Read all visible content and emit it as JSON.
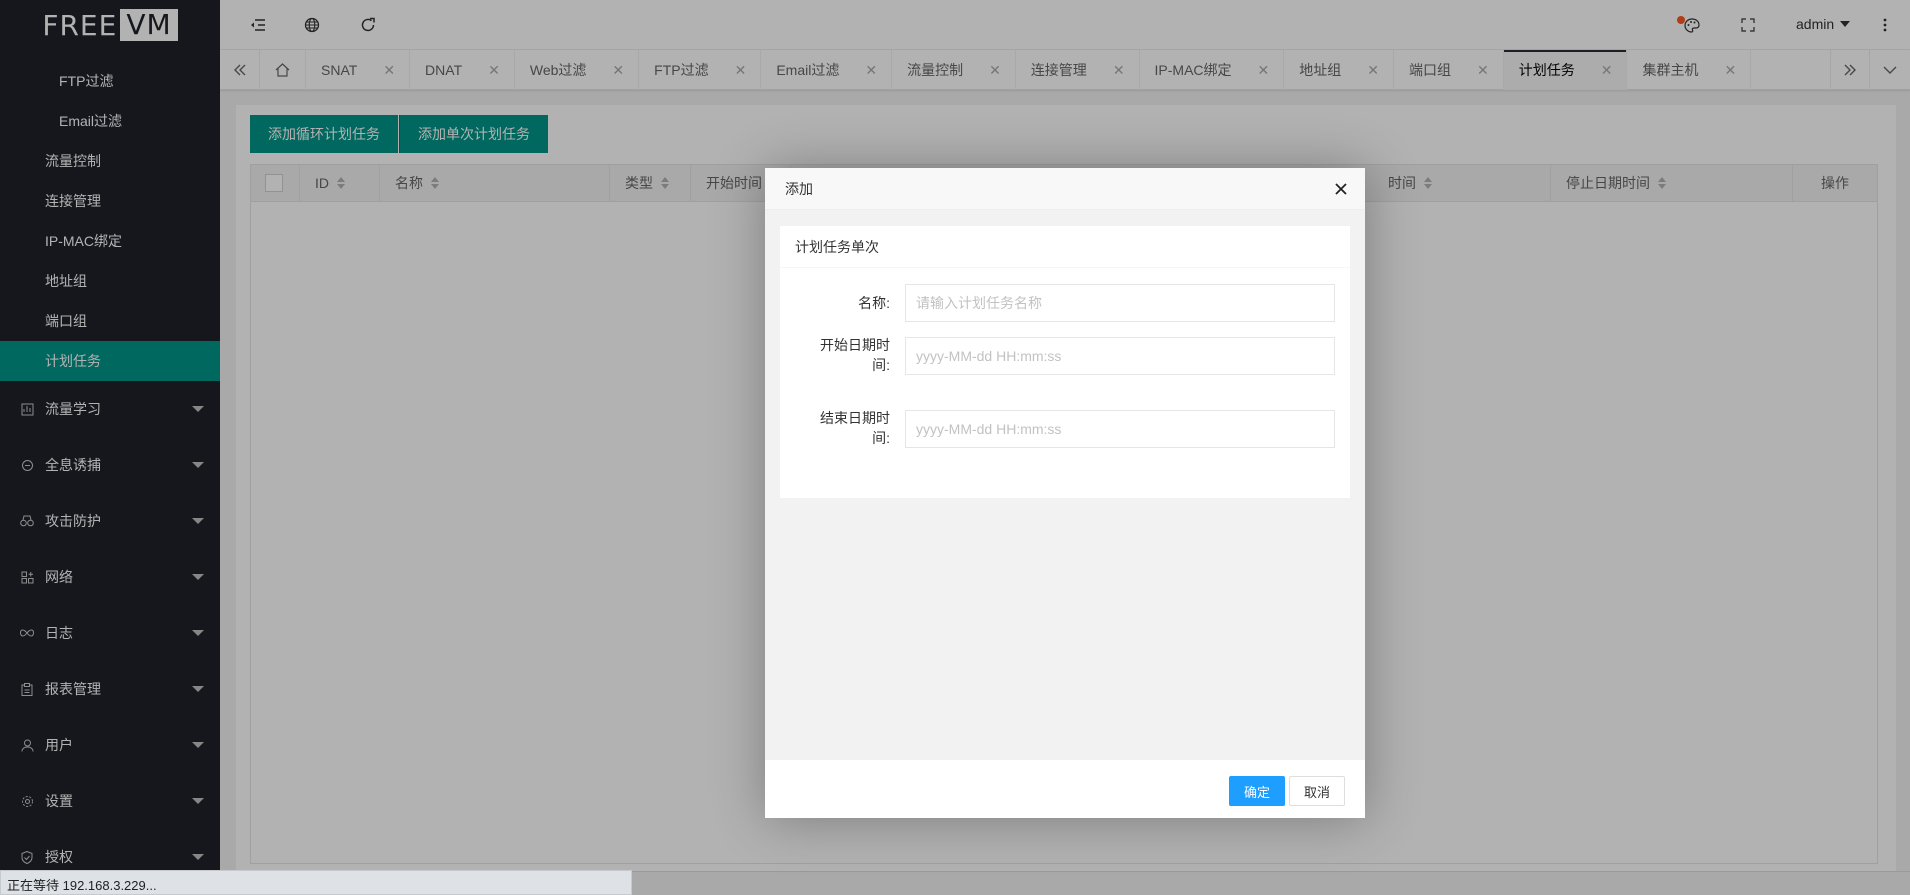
{
  "logo": {
    "part1": "FREE",
    "part2": "VM"
  },
  "sidebar": {
    "sub_items": [
      {
        "label": "FTP过滤",
        "level": 3
      },
      {
        "label": "Email过滤",
        "level": 3
      },
      {
        "label": "流量控制",
        "level": 2
      },
      {
        "label": "连接管理",
        "level": 2
      },
      {
        "label": "IP-MAC绑定",
        "level": 2
      },
      {
        "label": "地址组",
        "level": 2
      },
      {
        "label": "端口组",
        "level": 2
      },
      {
        "label": "计划任务",
        "level": 2,
        "active": true
      }
    ],
    "groups": [
      {
        "label": "流量学习",
        "icon": "chart-icon"
      },
      {
        "label": "全息诱捕",
        "icon": "refresh-circle-icon"
      },
      {
        "label": "攻击防护",
        "icon": "binoculars-icon"
      },
      {
        "label": "网络",
        "icon": "app-plus-icon"
      },
      {
        "label": "日志",
        "icon": "infinity-icon"
      },
      {
        "label": "报表管理",
        "icon": "clipboard-icon"
      },
      {
        "label": "用户",
        "icon": "user-icon"
      },
      {
        "label": "设置",
        "icon": "gear-icon"
      },
      {
        "label": "授权",
        "icon": "shield-check-icon"
      }
    ]
  },
  "header": {
    "user": "admin",
    "icons": [
      "menu-shrink-icon",
      "globe-icon",
      "refresh-icon",
      "palette-icon",
      "fullscreen-icon",
      "more-vertical-icon"
    ]
  },
  "tabs": {
    "items": [
      "SNAT",
      "DNAT",
      "Web过滤",
      "FTP过滤",
      "Email过滤",
      "流量控制",
      "连接管理",
      "IP-MAC绑定",
      "地址组",
      "端口组",
      "计划任务",
      "集群主机"
    ],
    "active_index": 10
  },
  "toolbar": {
    "add_recurring": "添加循环计划任务",
    "add_single": "添加单次计划任务"
  },
  "table": {
    "columns": [
      "ID",
      "名称",
      "类型",
      "开始时间",
      "时间",
      "停止日期时间",
      "操作"
    ]
  },
  "modal": {
    "title": "添加",
    "card_title": "计划任务单次",
    "fields": {
      "name": {
        "label": "名称:",
        "placeholder": "请输入计划任务名称",
        "value": ""
      },
      "start": {
        "label_line1": "开始日期时",
        "label_line2": "间:",
        "placeholder": "yyyy-MM-dd HH:mm:ss",
        "value": ""
      },
      "end": {
        "label_line1": "结束日期时",
        "label_line2": "间:",
        "placeholder": "yyyy-MM-dd HH:mm:ss",
        "value": ""
      }
    },
    "confirm": "确定",
    "cancel": "取消"
  },
  "statusbar": {
    "text": "正在等待 192.168.3.229..."
  },
  "colors": {
    "accent": "#009688",
    "sidebar_bg": "#20222a",
    "primary_button": "#1e9fff",
    "notify_dot": "#ff5722"
  }
}
